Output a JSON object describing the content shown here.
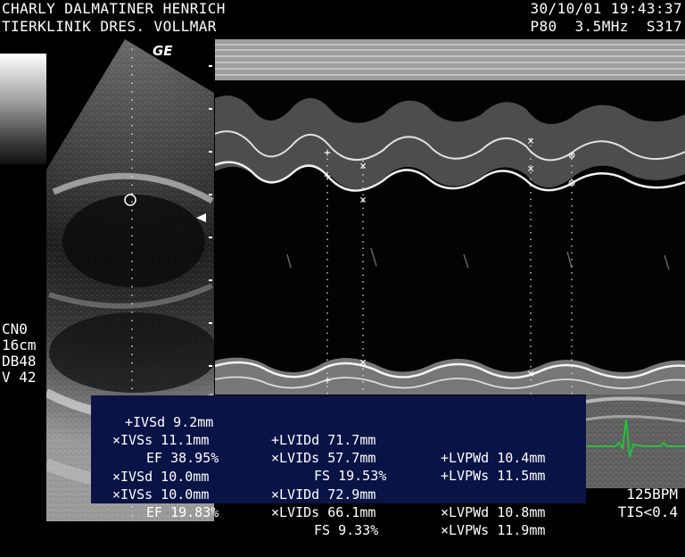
{
  "header": {
    "patient": "CHARLY DALMATINER HENRICH",
    "clinic": "TIERKLINIK DRES. VOLLMAR",
    "datetime": "30/10/01 19:43:37",
    "probe": "P80  3.5MHz  S317"
  },
  "logo": "GE",
  "side_params": [
    "CN0",
    "16cm",
    "DB48",
    "V 42"
  ],
  "measurements": {
    "rows": [
      [
        "+IVSd 9.2mm",
        "+LVIDd 71.7mm",
        "+LVPWd 10.4mm"
      ],
      [
        "×IVSs 11.1mm",
        "×LVIDs 57.7mm",
        "+LVPWs 11.5mm"
      ],
      [
        "EF 38.95%",
        "FS 19.53%",
        ""
      ],
      [
        "×IVSd 10.0mm",
        "×LVIDd 72.9mm",
        "×LVPWd 10.8mm"
      ],
      [
        "×IVSs 10.0mm",
        "×LVIDs 66.1mm",
        "×LVPWs 11.9mm"
      ],
      [
        "EF 19.83%",
        "FS 9.33%",
        ""
      ]
    ]
  },
  "heart_rate": "125BPM",
  "tis": "TIS<0.4",
  "colors": {
    "panel": "#0a1346",
    "ecg": "#22c33a"
  }
}
